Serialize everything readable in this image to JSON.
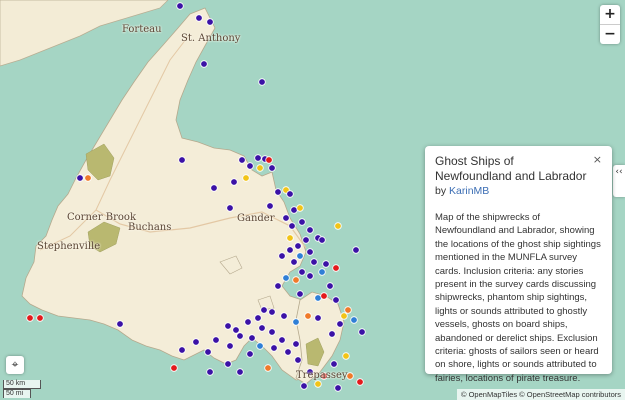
{
  "map": {
    "places": [
      {
        "id": "place-forteau",
        "name": "Forteau"
      },
      {
        "id": "place-st-anthony",
        "name": "St. Anthony"
      },
      {
        "id": "place-corner-brook",
        "name": "Corner Brook"
      },
      {
        "id": "place-buchans",
        "name": "Buchans"
      },
      {
        "id": "place-gander",
        "name": "Gander"
      },
      {
        "id": "place-stephenville",
        "name": "Stephenville"
      },
      {
        "id": "place-trepassey",
        "name": "Trepassey"
      }
    ],
    "marker_colors": {
      "indigo": "#3b12a6",
      "orange": "#f07a2a",
      "yellow": "#f2c418",
      "red": "#e31a1c",
      "blue": "#2f7fd6"
    }
  },
  "zoom": {
    "in_label": "+",
    "out_label": "−"
  },
  "panel_toggle": {
    "label": "‹‹"
  },
  "info": {
    "title": "Ghost Ships of Newfoundland and Labrador",
    "by_prefix": "by ",
    "author": "KarinMB",
    "close_label": "×",
    "description": "Map of the shipwrecks of Newfoundland and Labrador, showing the locations of the ghost ship sightings mentioned in the MUNFLA survey cards. Inclusion criteria: any stories present in the survey cards discussing shipwrecks, phantom ship sightings, lights or sounds attributed to ghostly vessels, ghosts on board ships, abandoned or derelict ships. Exclusion criteria: ghosts of sailors seen or heard on shore, lights or sounds attributed to fairies, locations of pirate treasure."
  },
  "locate": {
    "icon": "locate-icon",
    "glyph": "⌖"
  },
  "scale": {
    "km": "50 km",
    "mi": "50 mi"
  },
  "attribution": "© OpenMapTiles © OpenStreetMap contributors"
}
